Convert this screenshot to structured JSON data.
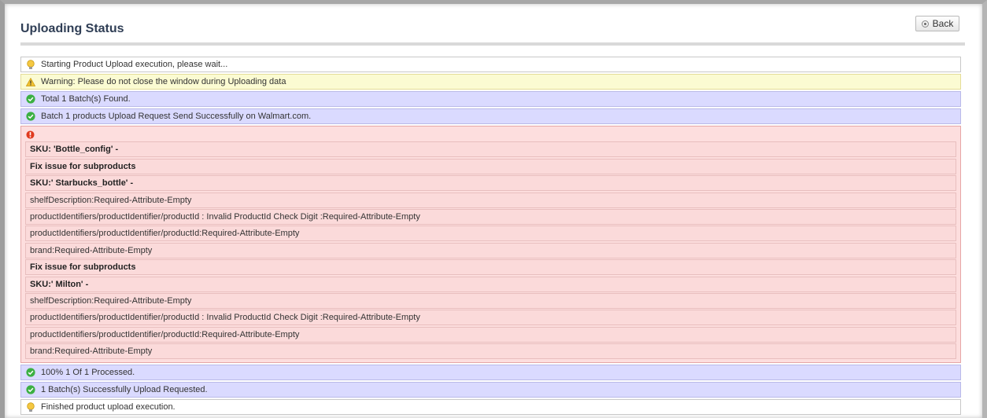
{
  "header": {
    "title": "Uploading Status",
    "back_label": "Back"
  },
  "messages_top": [
    {
      "type": "note",
      "icon": "lightbulb-icon",
      "text": "Starting Product Upload execution, please wait..."
    },
    {
      "type": "warning",
      "icon": "warning-icon",
      "text": "Warning: Please do not close the window during Uploading data"
    },
    {
      "type": "success",
      "icon": "check-circle-icon",
      "text": "Total 1 Batch(s) Found."
    },
    {
      "type": "success",
      "icon": "check-circle-icon",
      "text": "Batch 1 products Upload Request Send Successfully on Walmart.com."
    }
  ],
  "error_block": {
    "icon": "error-icon",
    "lines": [
      {
        "bold": true,
        "text": "SKU: 'Bottle_config' -"
      },
      {
        "bold": true,
        "text": "Fix issue for subproducts"
      },
      {
        "bold": true,
        "text": "SKU:' Starbucks_bottle' -"
      },
      {
        "bold": false,
        "text": "shelfDescription:Required-Attribute-Empty"
      },
      {
        "bold": false,
        "text": "productIdentifiers/productIdentifier/productId : Invalid ProductId Check Digit :Required-Attribute-Empty"
      },
      {
        "bold": false,
        "text": "productIdentifiers/productIdentifier/productId:Required-Attribute-Empty"
      },
      {
        "bold": false,
        "text": "brand:Required-Attribute-Empty"
      },
      {
        "bold": true,
        "text": "Fix issue for subproducts"
      },
      {
        "bold": true,
        "text": "SKU:' Milton' -"
      },
      {
        "bold": false,
        "text": "shelfDescription:Required-Attribute-Empty"
      },
      {
        "bold": false,
        "text": "productIdentifiers/productIdentifier/productId : Invalid ProductId Check Digit :Required-Attribute-Empty"
      },
      {
        "bold": false,
        "text": "productIdentifiers/productIdentifier/productId:Required-Attribute-Empty"
      },
      {
        "bold": false,
        "text": "brand:Required-Attribute-Empty"
      }
    ]
  },
  "messages_bottom": [
    {
      "type": "success",
      "icon": "check-circle-icon",
      "text": "100% 1 Of 1 Processed."
    },
    {
      "type": "success",
      "icon": "check-circle-icon",
      "text": "1 Batch(s) Successfully Upload Requested."
    },
    {
      "type": "note",
      "icon": "lightbulb-icon",
      "text": "Finished product upload execution."
    }
  ],
  "colors": {
    "title": "#2f3e55",
    "note_bg": "#ffffff",
    "warning_bg": "#fbfbd2",
    "success_bg": "#dadaff",
    "error_bg": "#fddede",
    "success_icon": "#3cb043",
    "error_icon": "#e03a1e"
  }
}
